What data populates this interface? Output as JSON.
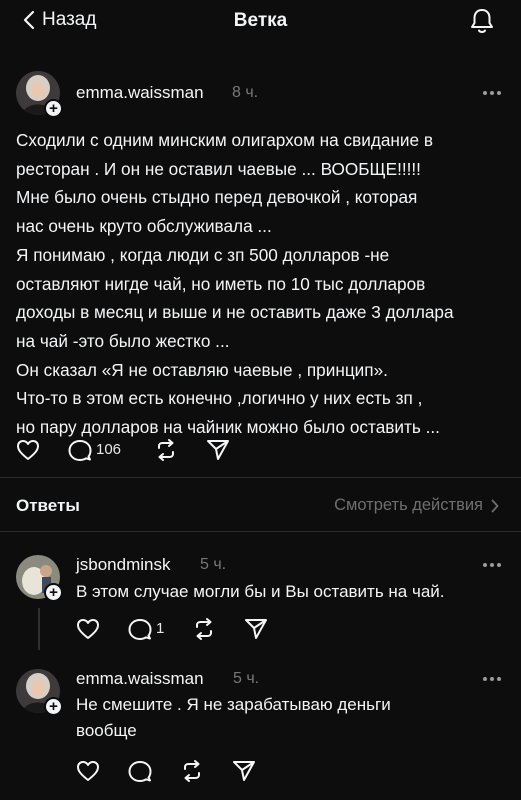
{
  "header": {
    "back_label": "Назад",
    "title": "Ветка"
  },
  "post": {
    "username": "emma.waissman",
    "time": "8 ч.",
    "lines": [
      "Сходили с одним минским олигархом на свидание в",
      "ресторан . И он не оставил чаевые ... ВООБЩЕ!!!!!",
      "Мне было очень стыдно перед девочкой , которая",
      "нас очень круто обслуживала ...",
      "Я понимаю , когда люди с зп 500 долларов -не",
      "оставляют нигде чай, но иметь по 10 тыс долларов",
      "доходы в месяц и выше и не оставить даже 3 доллара",
      "на чай -это было жестко ...",
      "Он сказал «Я не оставляю чаевые , принцип».",
      "Что-то в этом есть конечно ,логично у них есть зп ,",
      "но пару долларов на чайник можно было оставить ..."
    ],
    "reply_count": "106"
  },
  "replies_section": {
    "label": "Ответы",
    "view_actions": "Смотреть действия"
  },
  "replies": [
    {
      "username": "jsbondminsk",
      "time": "5 ч.",
      "lines": [
        "В этом случае могли бы и Вы оставить на чай."
      ],
      "reply_count": "1"
    },
    {
      "username": "emma.waissman",
      "time": "5 ч.",
      "lines": [
        "Не смешите . Я не зарабатываю деньги",
        "вообще"
      ],
      "reply_count": ""
    }
  ],
  "colors": {
    "background": "#0d0d0d",
    "text": "#f3f5f7",
    "muted": "#777777"
  }
}
